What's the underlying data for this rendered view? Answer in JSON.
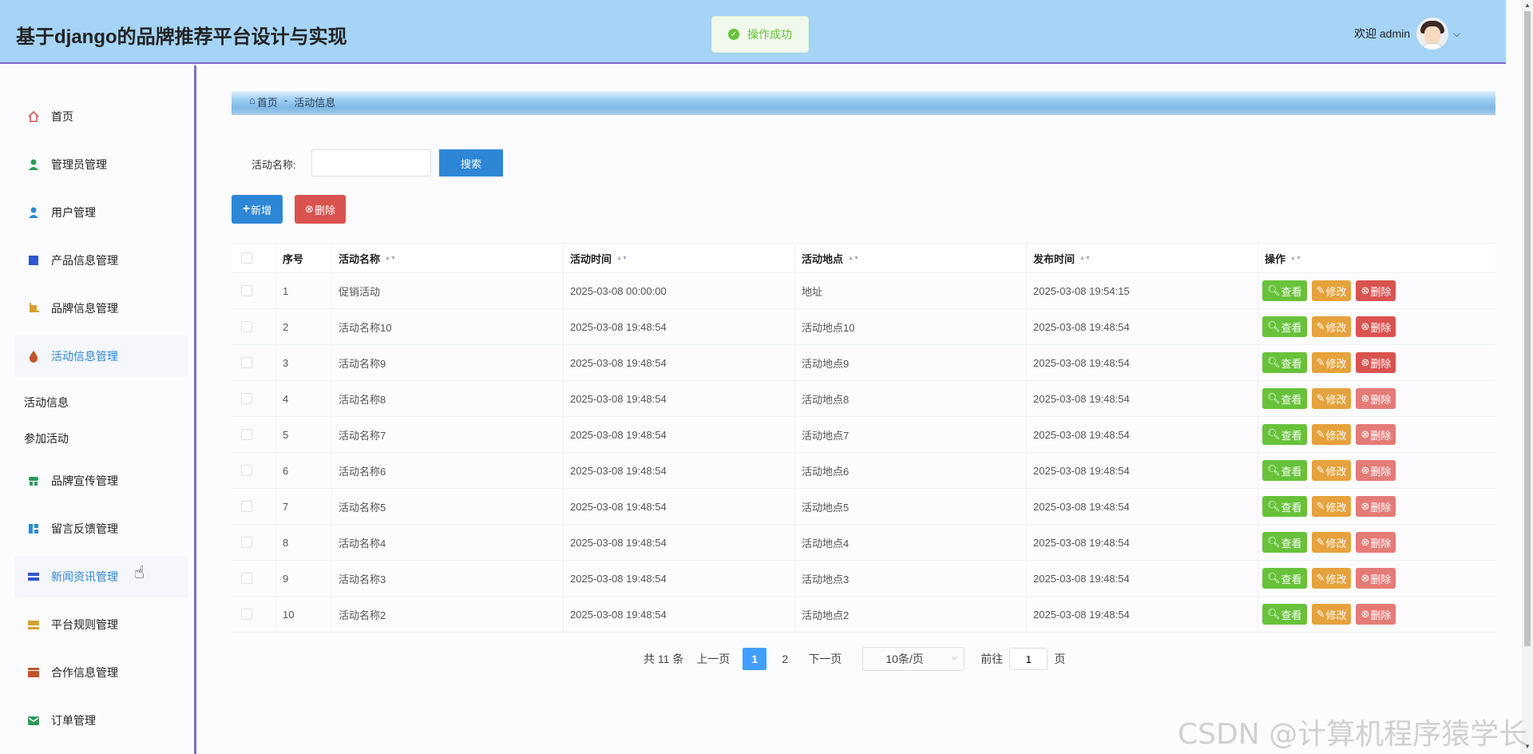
{
  "app": {
    "title": "基于django的品牌推荐平台设计与实现"
  },
  "toast": {
    "text": "操作成功",
    "icon": "check-circle-icon"
  },
  "user": {
    "welcome": "欢迎 admin"
  },
  "sidebar": {
    "items": [
      {
        "label": "首页",
        "icon": "home-icon",
        "color": "#d9534f"
      },
      {
        "label": "管理员管理",
        "icon": "user-icon",
        "color": "#2e9a5a"
      },
      {
        "label": "用户管理",
        "icon": "user-icon",
        "color": "#2a8bd1"
      },
      {
        "label": "产品信息管理",
        "icon": "square-icon",
        "color": "#2f55d4"
      },
      {
        "label": "品牌信息管理",
        "icon": "crop-icon",
        "color": "#d4a12f"
      },
      {
        "label": "活动信息管理",
        "icon": "drop-icon",
        "color": "#c0552a"
      },
      {
        "label": "品牌宣传管理",
        "icon": "shop-icon",
        "color": "#2e9a5a"
      },
      {
        "label": "留言反馈管理",
        "icon": "grid-icon",
        "color": "#2a8bd1"
      },
      {
        "label": "新闻资讯管理",
        "icon": "list-icon",
        "color": "#2f55d4"
      },
      {
        "label": "平台规则管理",
        "icon": "layers-icon",
        "color": "#d4a12f"
      },
      {
        "label": "合作信息管理",
        "icon": "box-icon",
        "color": "#c0552a"
      },
      {
        "label": "订单管理",
        "icon": "mail-icon",
        "color": "#2e9a5a"
      }
    ],
    "subitems": [
      {
        "label": "活动信息"
      },
      {
        "label": "参加活动"
      }
    ]
  },
  "breadcrumb": {
    "home": "首页",
    "separator": "-",
    "current": "活动信息"
  },
  "search": {
    "label": "活动名称:",
    "value": "",
    "placeholder": "",
    "button": "搜索"
  },
  "toolbar": {
    "add_label": "新增",
    "delete_label": "删除"
  },
  "table": {
    "columns": [
      "序号",
      "活动名称",
      "活动时间",
      "活动地点",
      "发布时间",
      "操作"
    ],
    "rows": [
      {
        "no": "1",
        "name": "促销活动",
        "time": "2025-03-08 00:00:00",
        "place": "地址",
        "publish": "2025-03-08 19:54:15"
      },
      {
        "no": "2",
        "name": "活动名称10",
        "time": "2025-03-08 19:48:54",
        "place": "活动地点10",
        "publish": "2025-03-08 19:48:54"
      },
      {
        "no": "3",
        "name": "活动名称9",
        "time": "2025-03-08 19:48:54",
        "place": "活动地点9",
        "publish": "2025-03-08 19:48:54"
      },
      {
        "no": "4",
        "name": "活动名称8",
        "time": "2025-03-08 19:48:54",
        "place": "活动地点8",
        "publish": "2025-03-08 19:48:54"
      },
      {
        "no": "5",
        "name": "活动名称7",
        "time": "2025-03-08 19:48:54",
        "place": "活动地点7",
        "publish": "2025-03-08 19:48:54"
      },
      {
        "no": "6",
        "name": "活动名称6",
        "time": "2025-03-08 19:48:54",
        "place": "活动地点6",
        "publish": "2025-03-08 19:48:54"
      },
      {
        "no": "7",
        "name": "活动名称5",
        "time": "2025-03-08 19:48:54",
        "place": "活动地点5",
        "publish": "2025-03-08 19:48:54"
      },
      {
        "no": "8",
        "name": "活动名称4",
        "time": "2025-03-08 19:48:54",
        "place": "活动地点4",
        "publish": "2025-03-08 19:48:54"
      },
      {
        "no": "9",
        "name": "活动名称3",
        "time": "2025-03-08 19:48:54",
        "place": "活动地点3",
        "publish": "2025-03-08 19:48:54"
      },
      {
        "no": "10",
        "name": "活动名称2",
        "time": "2025-03-08 19:48:54",
        "place": "活动地点2",
        "publish": "2025-03-08 19:48:54"
      }
    ],
    "actions": {
      "view": "查看",
      "edit": "修改",
      "delete": "删除"
    }
  },
  "pagination": {
    "total": "共 11 条",
    "prev": "上一页",
    "pages": [
      "1",
      "2"
    ],
    "current": "1",
    "next": "下一页",
    "page_size": "10条/页",
    "goto_label": "前往",
    "goto_value": "1",
    "page_unit": "页"
  },
  "watermark": "CSDN @计算机程序猿学长"
}
